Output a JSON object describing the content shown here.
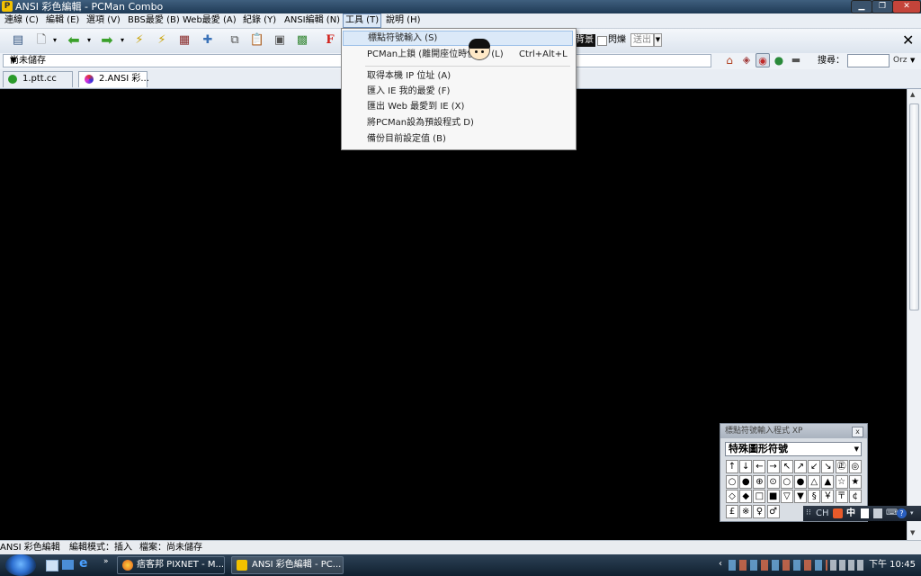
{
  "window": {
    "title": "ANSI 彩色編輯 - PCMan Combo"
  },
  "menubar": {
    "items": [
      {
        "label": "連線 (C)"
      },
      {
        "label": "編輯 (E)"
      },
      {
        "label": "選項 (V)"
      },
      {
        "label": "BBS最愛 (B)"
      },
      {
        "label": "Web最愛 (A)"
      },
      {
        "label": "紀錄 (Y)"
      },
      {
        "label": "ANSI編輯 (N)"
      },
      {
        "label": "工具 (T)"
      },
      {
        "label": "說明 (H)"
      }
    ]
  },
  "toolbar": {
    "color_label": "背景",
    "blink_label": "閃爍",
    "send_label": "送出",
    "search_label": "搜尋：",
    "search_value": "",
    "search_engine": "Orz"
  },
  "address": {
    "value": "尚未儲存"
  },
  "tabs": [
    {
      "label": "1.ptt.cc"
    },
    {
      "label": "2.ANSI 彩..."
    }
  ],
  "tools_menu": {
    "items": [
      {
        "label": "標點符號輸入 (S)",
        "shortcut": ""
      },
      {
        "label": "PCMan上鎖 (離開座位時使用) (L)",
        "shortcut": "Ctrl+Alt+L"
      },
      {
        "label": "取得本機 IP 位址 (A)",
        "shortcut": ""
      },
      {
        "label": "匯入 IE 我的最愛 (F)",
        "shortcut": ""
      },
      {
        "label": "匯出 Web 最愛到 IE (X)",
        "shortcut": ""
      },
      {
        "label": "將PCMan設為預設程式 D)",
        "shortcut": ""
      },
      {
        "label": "備份目前設定值 (B)",
        "shortcut": ""
      }
    ]
  },
  "ime_panel": {
    "title": "標點符號輸入程式 XP",
    "category": "特殊圖形符號",
    "rows": [
      [
        "↑",
        "↓",
        "←",
        "→",
        "↖",
        "↗",
        "↙",
        "↘",
        "㊣",
        "◎"
      ],
      [
        "○",
        "●",
        "⊕",
        "⊙",
        "○",
        "●",
        "△",
        "▲",
        "☆",
        "★"
      ],
      [
        "◇",
        "◆",
        "□",
        "■",
        "▽",
        "▼",
        "§",
        "￥",
        "〒",
        "¢"
      ],
      [
        "£",
        "※",
        "♀",
        "♂"
      ]
    ]
  },
  "langbar": {
    "lang": "CH",
    "mode": "中"
  },
  "statusbar": {
    "app": "ANSI 彩色編輯",
    "mode": "編輯模式：插入",
    "file": "檔案：尚未儲存"
  },
  "taskbar": {
    "tasks": [
      {
        "label": "痞客邦 PIXNET - M..."
      },
      {
        "label": "ANSI 彩色編輯 - PC..."
      }
    ],
    "clock": "下午 10:45"
  },
  "colors": {
    "terminal_bg": "#000000",
    "menu_highlight": "#dbe9f8",
    "title_bar": "#2b4763"
  }
}
